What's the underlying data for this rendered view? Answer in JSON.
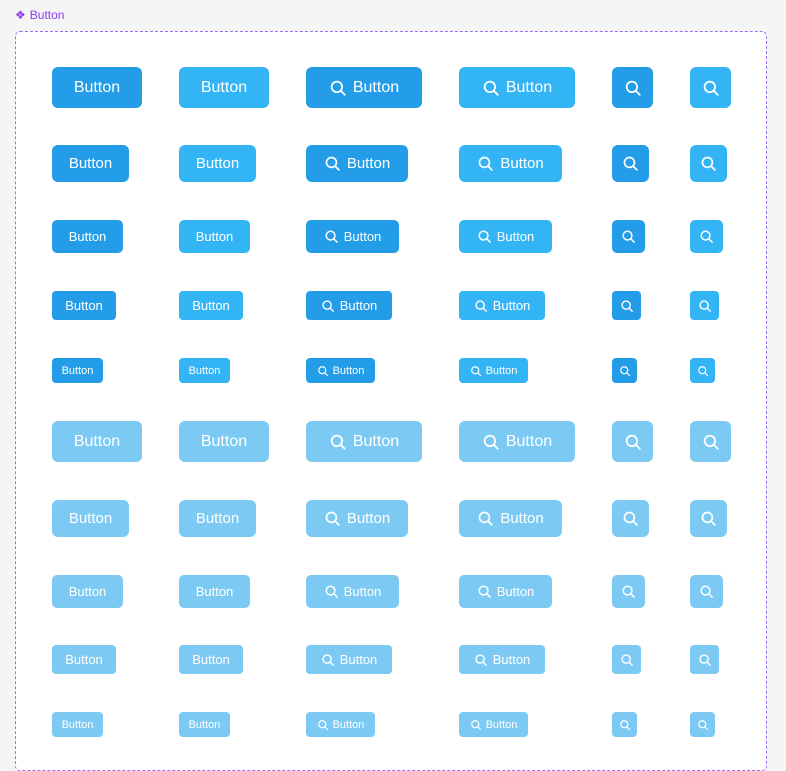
{
  "component": {
    "name": "Button",
    "icon": "component-icon"
  },
  "button_label": "Button",
  "icon": "search-icon",
  "colors": {
    "primary": "#239de8",
    "secondary": "#33b4f5",
    "disabled": "#7ccaf3",
    "frame_border": "#9e6cf3",
    "label_text": "#8b3cf2"
  },
  "variants": [
    {
      "column": 1,
      "color": "primary",
      "content": "text"
    },
    {
      "column": 2,
      "color": "secondary",
      "content": "text"
    },
    {
      "column": 3,
      "color": "primary",
      "content": "icon-text"
    },
    {
      "column": 4,
      "color": "secondary",
      "content": "icon-text"
    },
    {
      "column": 5,
      "color": "primary",
      "content": "icon"
    },
    {
      "column": 6,
      "color": "secondary",
      "content": "icon"
    }
  ],
  "sizes": [
    "xl",
    "lg",
    "md",
    "sm",
    "xs"
  ],
  "states": [
    "enabled",
    "disabled"
  ]
}
